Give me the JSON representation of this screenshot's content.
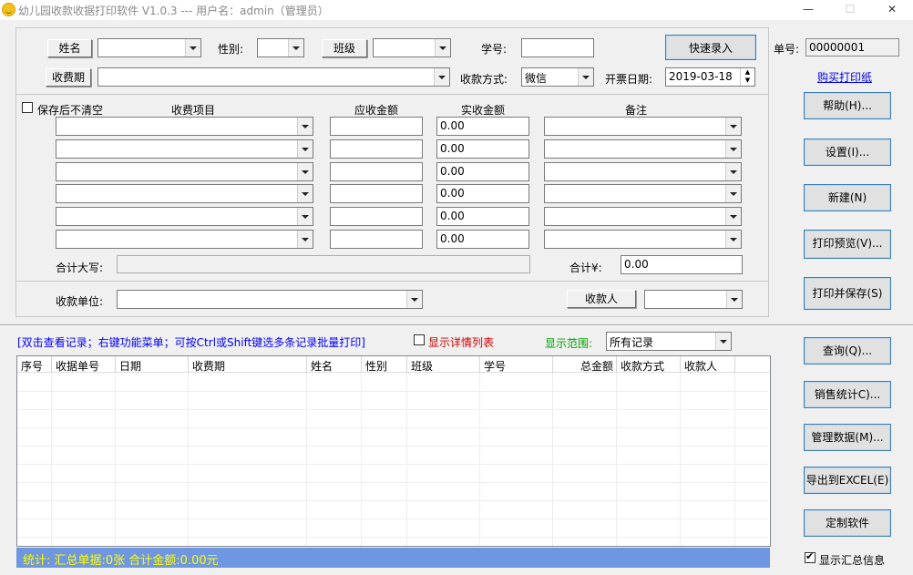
{
  "window": {
    "title": "幼儿园收款收据打印软件 V1.0.3 --- 用户名：admin（管理员）",
    "minimize": "—",
    "maximize": "☐",
    "close": "✕"
  },
  "form": {
    "name_btn": "姓名",
    "gender_label": "性别:",
    "class_btn": "班级",
    "student_no_label": "学号:",
    "quick_entry_btn": "快速录入",
    "period_btn": "收费期",
    "pay_method_label": "收款方式:",
    "pay_method_value": "微信",
    "invoice_date_label": "开票日期:",
    "invoice_date_value": "2019-03-18",
    "keep_after_save": "保存后不清空",
    "col_item": "收费项目",
    "col_due": "应收金额",
    "col_paid": "实收金额",
    "col_note": "备注",
    "rows": [
      {
        "paid": "0.00"
      },
      {
        "paid": "0.00"
      },
      {
        "paid": "0.00"
      },
      {
        "paid": "0.00"
      },
      {
        "paid": "0.00"
      },
      {
        "paid": "0.00"
      }
    ],
    "total_caps_label": "合计大写:",
    "total_label": "合计¥:",
    "total_value": "0.00",
    "payee_unit_label": "收款单位:",
    "payee_btn": "收款人"
  },
  "right_panel": {
    "receipt_no_label": "单号:",
    "receipt_no_value": "00000001",
    "buy_paper_link": "购买打印纸",
    "help_btn": "帮助(H)...",
    "settings_btn": "设置(I)...",
    "new_btn": "新建(N)",
    "preview_btn": "打印预览(V)...",
    "print_save_btn": "打印并保存(S)",
    "query_btn": "查询(Q)...",
    "sales_stats_btn": "销售统计C)...",
    "manage_btn": "管理数据(M)...",
    "export_btn": "导出到EXCEL(E)",
    "custom_btn": "定制软件",
    "show_summary": "显示汇总信息"
  },
  "records": {
    "hint": "[双击查看记录；右键功能菜单；可按Ctrl或Shift键选多条记录批量打印]",
    "show_detail": "显示详情列表",
    "range_label": "显示范围:",
    "range_value": "所有记录",
    "columns": [
      "序号",
      "收据单号",
      "日期",
      "收费期",
      "姓名",
      "性别",
      "班级",
      "学号",
      "总金额",
      "收款方式",
      "收款人"
    ],
    "status": "统计: 汇总单据:0张 合计金额:0.00元"
  },
  "colors": {
    "status_bar": "#6f96e0",
    "status_text": "#ffff00",
    "hint_text": "#0000ff",
    "detail_text": "#d00000",
    "range_text": "#00a000",
    "link": "#0000ee"
  }
}
